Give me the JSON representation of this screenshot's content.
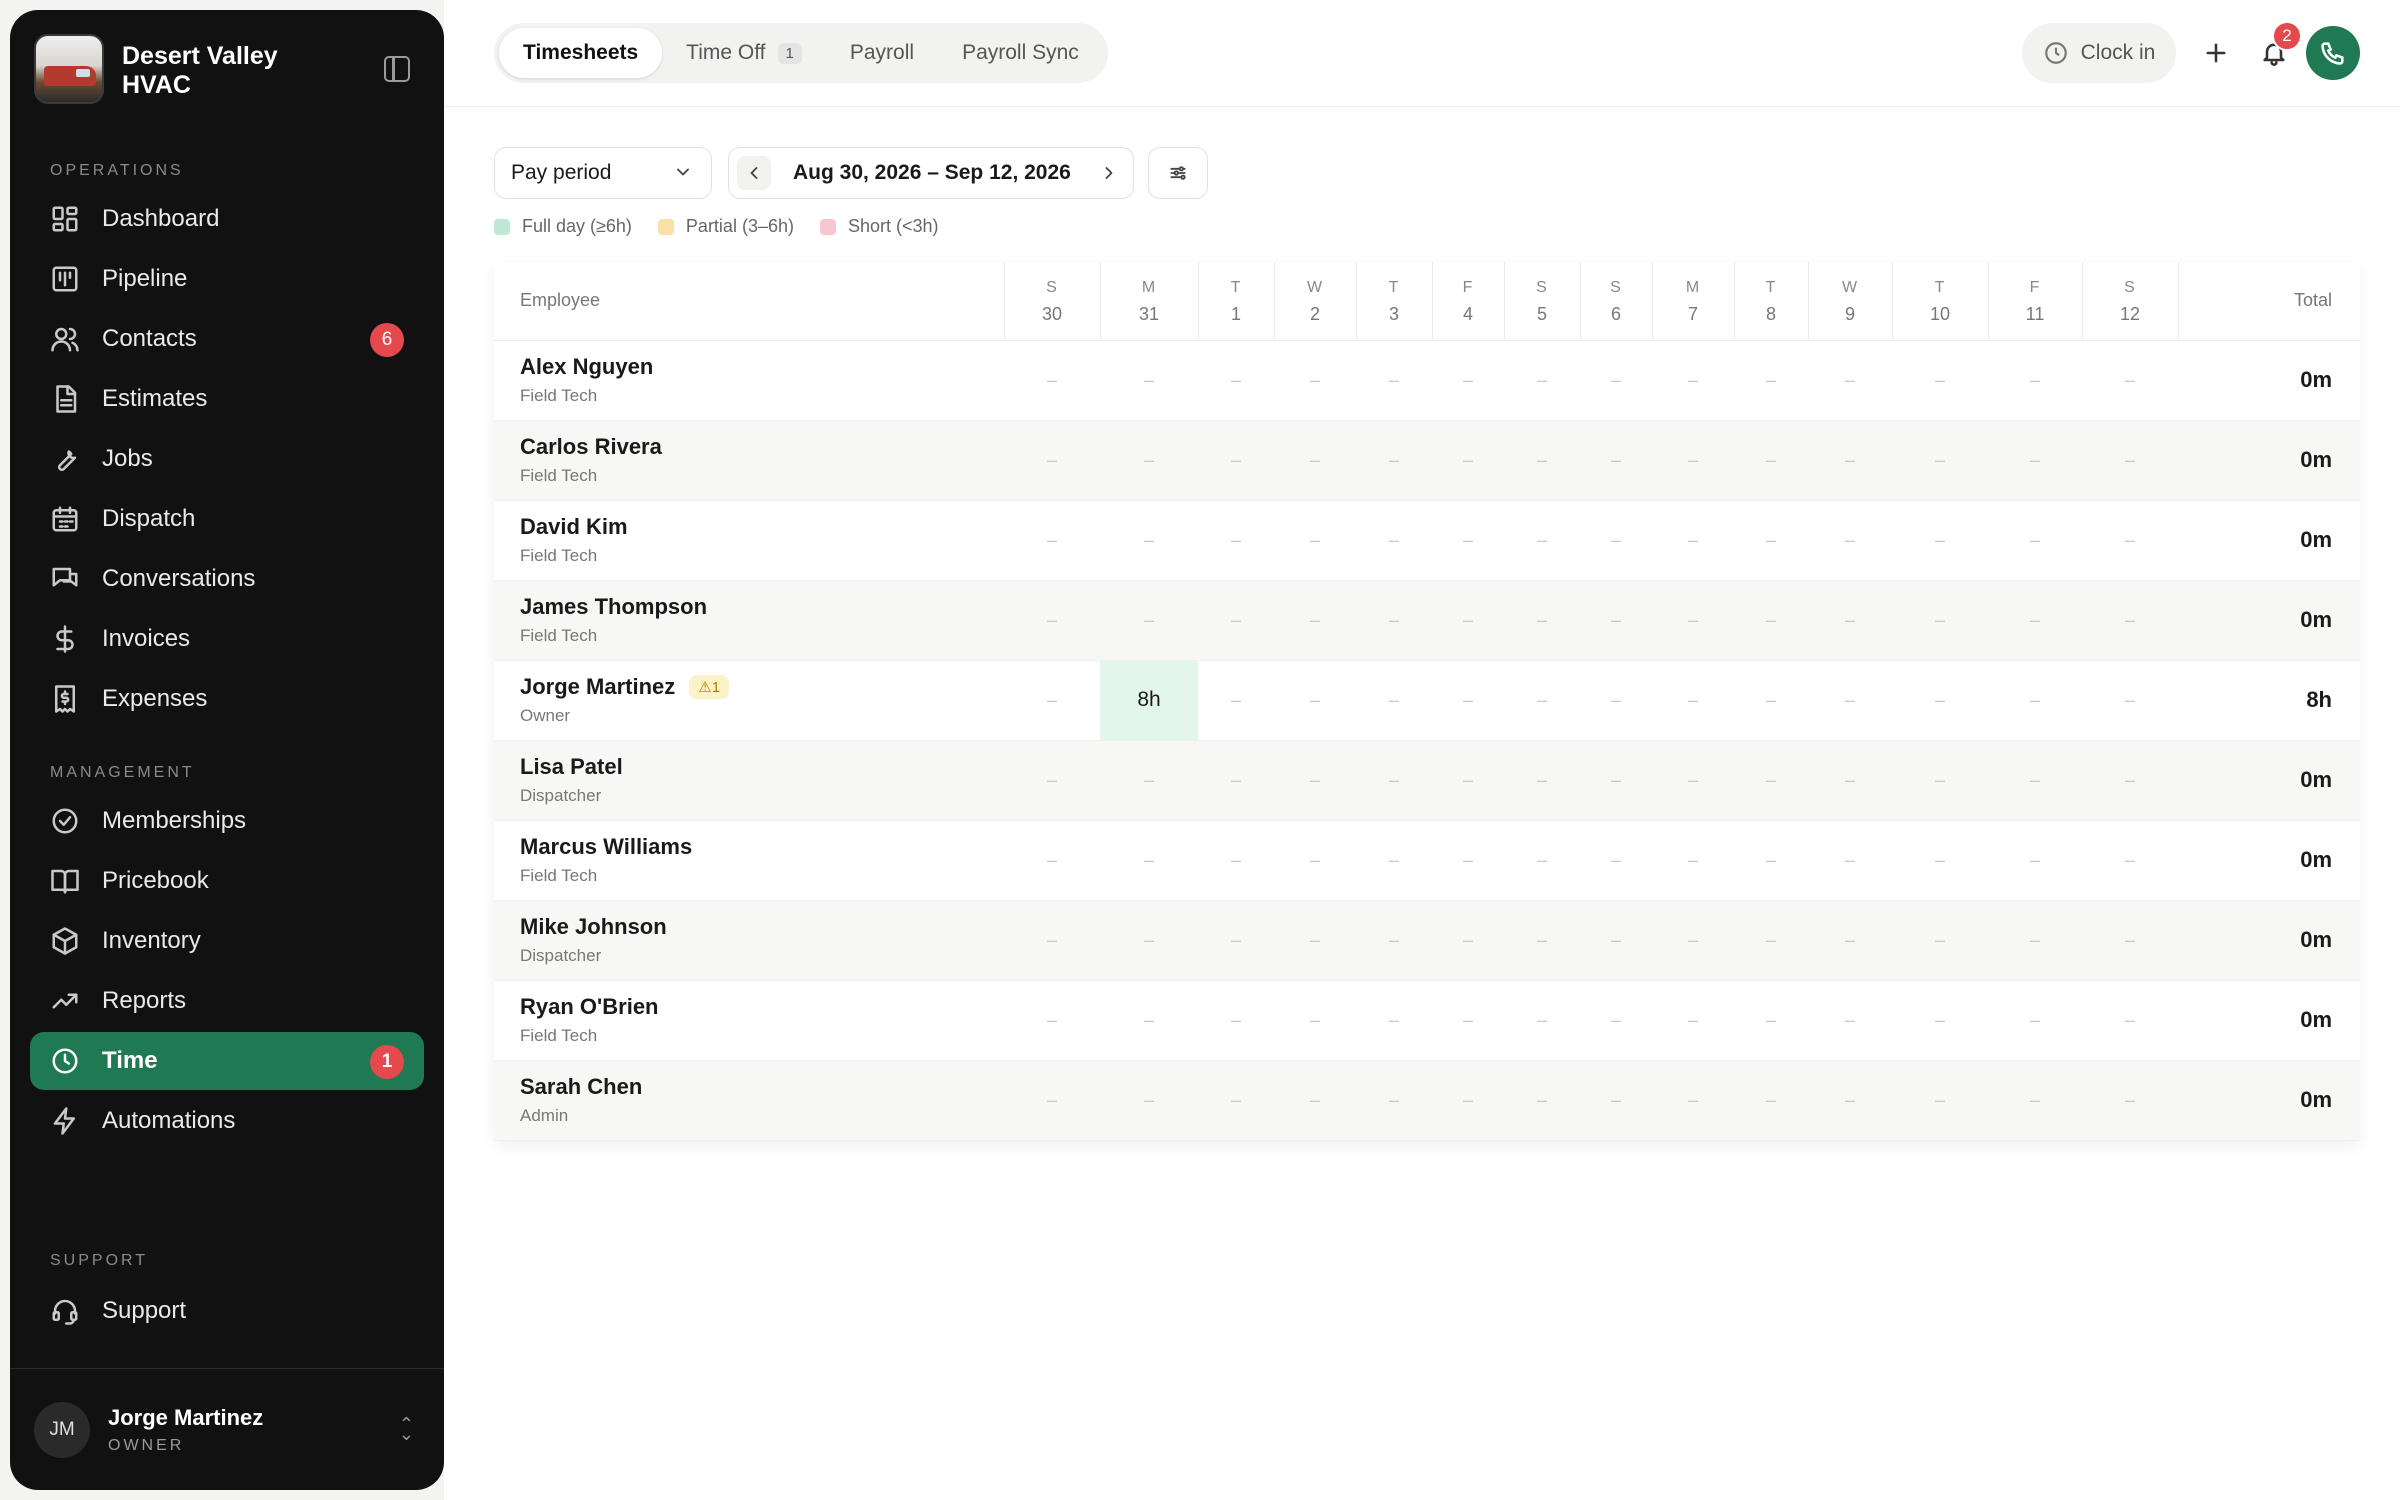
{
  "brand": {
    "name": "Desert Valley HVAC"
  },
  "sidebar": {
    "sections": [
      {
        "label": "OPERATIONS",
        "items": [
          {
            "label": "Dashboard",
            "icon": "dashboard-icon"
          },
          {
            "label": "Pipeline",
            "icon": "pipeline-icon"
          },
          {
            "label": "Contacts",
            "icon": "contacts-icon",
            "badge": "6"
          },
          {
            "label": "Estimates",
            "icon": "estimates-icon"
          },
          {
            "label": "Jobs",
            "icon": "wrench-icon"
          },
          {
            "label": "Dispatch",
            "icon": "calendar-icon"
          },
          {
            "label": "Conversations",
            "icon": "chat-icon"
          },
          {
            "label": "Invoices",
            "icon": "dollar-icon"
          },
          {
            "label": "Expenses",
            "icon": "receipt-icon"
          }
        ]
      },
      {
        "label": "MANAGEMENT",
        "items": [
          {
            "label": "Memberships",
            "icon": "badge-check-icon"
          },
          {
            "label": "Pricebook",
            "icon": "book-icon"
          },
          {
            "label": "Inventory",
            "icon": "box-icon"
          },
          {
            "label": "Reports",
            "icon": "trend-icon"
          },
          {
            "label": "Time",
            "icon": "clock-icon",
            "badge": "1",
            "active": true
          },
          {
            "label": "Automations",
            "icon": "bolt-icon"
          }
        ]
      }
    ],
    "support": {
      "label": "SUPPORT",
      "item": "Support"
    },
    "user": {
      "initials": "JM",
      "name": "Jorge Martinez",
      "role": "OWNER"
    }
  },
  "header": {
    "tabs": [
      {
        "label": "Timesheets",
        "active": true
      },
      {
        "label": "Time Off",
        "count": "1"
      },
      {
        "label": "Payroll"
      },
      {
        "label": "Payroll Sync"
      }
    ],
    "clock_in_label": "Clock in",
    "notifications_count": "2"
  },
  "controls": {
    "period_select": "Pay period",
    "date_range": "Aug 30, 2026 – Sep 12, 2026"
  },
  "legend": [
    {
      "label": "Full day (≥6h)",
      "color": "#bfe9d4"
    },
    {
      "label": "Partial (3–6h)",
      "color": "#fbe0a6"
    },
    {
      "label": "Short (<3h)",
      "color": "#f7c6cf"
    }
  ],
  "table": {
    "employee_header": "Employee",
    "total_header": "Total",
    "days": [
      {
        "letter": "S",
        "num": "30"
      },
      {
        "letter": "M",
        "num": "31"
      },
      {
        "letter": "T",
        "num": "1"
      },
      {
        "letter": "W",
        "num": "2"
      },
      {
        "letter": "T",
        "num": "3"
      },
      {
        "letter": "F",
        "num": "4"
      },
      {
        "letter": "S",
        "num": "5"
      },
      {
        "letter": "S",
        "num": "6"
      },
      {
        "letter": "M",
        "num": "7"
      },
      {
        "letter": "T",
        "num": "8"
      },
      {
        "letter": "W",
        "num": "9"
      },
      {
        "letter": "T",
        "num": "10"
      },
      {
        "letter": "F",
        "num": "11"
      },
      {
        "letter": "S",
        "num": "12"
      }
    ],
    "rows": [
      {
        "name": "Alex Nguyen",
        "role": "Field Tech",
        "cells": [
          "–",
          "–",
          "–",
          "–",
          "–",
          "–",
          "–",
          "–",
          "–",
          "–",
          "–",
          "–",
          "–",
          "–"
        ],
        "total": "0m"
      },
      {
        "name": "Carlos Rivera",
        "role": "Field Tech",
        "cells": [
          "–",
          "–",
          "–",
          "–",
          "–",
          "–",
          "–",
          "–",
          "–",
          "–",
          "–",
          "–",
          "–",
          "–"
        ],
        "total": "0m"
      },
      {
        "name": "David Kim",
        "role": "Field Tech",
        "cells": [
          "–",
          "–",
          "–",
          "–",
          "–",
          "–",
          "–",
          "–",
          "–",
          "–",
          "–",
          "–",
          "–",
          "–"
        ],
        "total": "0m"
      },
      {
        "name": "James Thompson",
        "role": "Field Tech",
        "cells": [
          "–",
          "–",
          "–",
          "–",
          "–",
          "–",
          "–",
          "–",
          "–",
          "–",
          "–",
          "–",
          "–",
          "–"
        ],
        "total": "0m"
      },
      {
        "name": "Jorge Martinez",
        "role": "Owner",
        "warning": "1",
        "cells": [
          "–",
          "8h",
          "–",
          "–",
          "–",
          "–",
          "–",
          "–",
          "–",
          "–",
          "–",
          "–",
          "–",
          "–"
        ],
        "full": [
          1
        ],
        "total": "8h"
      },
      {
        "name": "Lisa Patel",
        "role": "Dispatcher",
        "cells": [
          "–",
          "–",
          "–",
          "–",
          "–",
          "–",
          "–",
          "–",
          "–",
          "–",
          "–",
          "–",
          "–",
          "–"
        ],
        "total": "0m"
      },
      {
        "name": "Marcus Williams",
        "role": "Field Tech",
        "cells": [
          "–",
          "–",
          "–",
          "–",
          "–",
          "–",
          "–",
          "–",
          "–",
          "–",
          "–",
          "–",
          "–",
          "–"
        ],
        "total": "0m"
      },
      {
        "name": "Mike Johnson",
        "role": "Dispatcher",
        "cells": [
          "–",
          "–",
          "–",
          "–",
          "–",
          "–",
          "–",
          "–",
          "–",
          "–",
          "–",
          "–",
          "–",
          "–"
        ],
        "total": "0m"
      },
      {
        "name": "Ryan O'Brien",
        "role": "Field Tech",
        "cells": [
          "–",
          "–",
          "–",
          "–",
          "–",
          "–",
          "–",
          "–",
          "–",
          "–",
          "–",
          "–",
          "–",
          "–"
        ],
        "total": "0m"
      },
      {
        "name": "Sarah Chen",
        "role": "Admin",
        "cells": [
          "–",
          "–",
          "–",
          "–",
          "–",
          "–",
          "–",
          "–",
          "–",
          "–",
          "–",
          "–",
          "–",
          "–"
        ],
        "total": "0m"
      }
    ]
  }
}
